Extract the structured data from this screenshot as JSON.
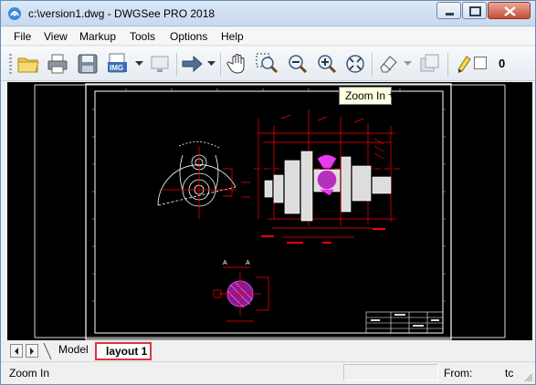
{
  "window": {
    "title": "c:\\version1.dwg - DWGSee PRO 2018"
  },
  "menu": {
    "items": [
      "File",
      "View",
      "Markup",
      "Tools",
      "Options",
      "Help"
    ]
  },
  "toolbar": {
    "buttons": [
      "open-folder-icon",
      "print-icon",
      "save-icon",
      "export-image-icon",
      "display-icon",
      "arrow-right-icon",
      "pan-hand-icon",
      "zoom-window-icon",
      "zoom-out-icon",
      "zoom-in-icon",
      "zoom-extents-icon",
      "eraser-icon",
      "layers-icon"
    ],
    "count": "0"
  },
  "drawing": {
    "tooltip": "Zoom In",
    "cursor": "+",
    "line_color": "#ff0000",
    "accent_color": "#e23ee8",
    "frame_color": "#ffffff",
    "section_label_a": "A",
    "section_label_a2": "A"
  },
  "tabs": {
    "model": "Model",
    "layout": "layout 1",
    "highlight_color": "#e0343b"
  },
  "status": {
    "message": "Zoom In",
    "from_label": "From:",
    "to_label": "tc"
  }
}
